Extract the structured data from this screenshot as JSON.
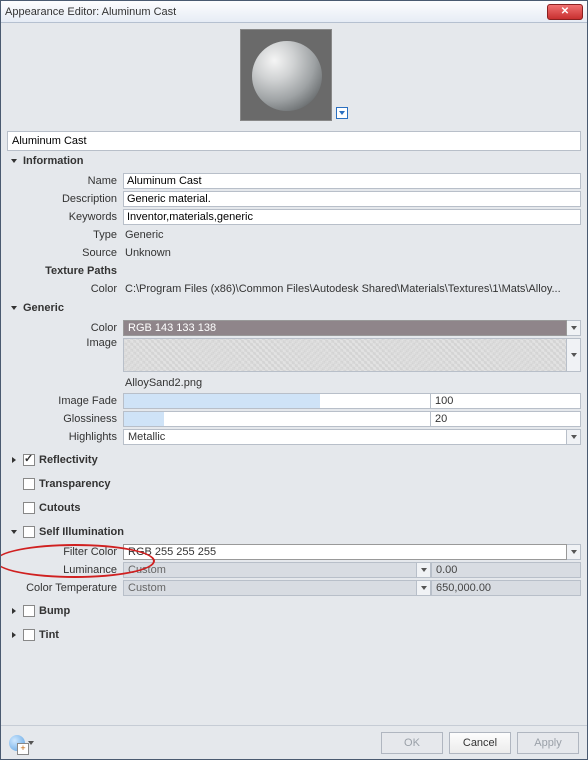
{
  "window": {
    "title": "Appearance Editor: Aluminum Cast"
  },
  "name_field": "Aluminum Cast",
  "sections": {
    "information": {
      "label": "Information",
      "name_lbl": "Name",
      "name_val": "Aluminum Cast",
      "desc_lbl": "Description",
      "desc_val": "Generic material.",
      "keyw_lbl": "Keywords",
      "keyw_val": "Inventor,materials,generic",
      "type_lbl": "Type",
      "type_val": "Generic",
      "source_lbl": "Source",
      "source_val": "Unknown",
      "texpaths_lbl": "Texture Paths",
      "color_lbl": "Color",
      "color_val": "C:\\Program Files (x86)\\Common Files\\Autodesk Shared\\Materials\\Textures\\1\\Mats\\Alloy..."
    },
    "generic": {
      "label": "Generic",
      "color_lbl": "Color",
      "color_val": "RGB 143 133 138",
      "image_lbl": "Image",
      "image_file": "AlloySand2.png",
      "fade_lbl": "Image Fade",
      "fade_val": "100",
      "fade_pct": 64,
      "gloss_lbl": "Glossiness",
      "gloss_val": "20",
      "gloss_pct": 13,
      "high_lbl": "Highlights",
      "high_val": "Metallic"
    },
    "reflectivity": {
      "label": "Reflectivity"
    },
    "transparency": {
      "label": "Transparency"
    },
    "cutouts": {
      "label": "Cutouts"
    },
    "selfillum": {
      "label": "Self Illumination",
      "filter_lbl": "Filter Color",
      "filter_val": "RGB 255 255 255",
      "lum_lbl": "Luminance",
      "lum_sel": "Custom",
      "lum_val": "0.00",
      "ct_lbl": "Color Temperature",
      "ct_sel": "Custom",
      "ct_val": "650,000.00"
    },
    "bump": {
      "label": "Bump"
    },
    "tint": {
      "label": "Tint"
    }
  },
  "footer": {
    "ok": "OK",
    "cancel": "Cancel",
    "apply": "Apply"
  }
}
